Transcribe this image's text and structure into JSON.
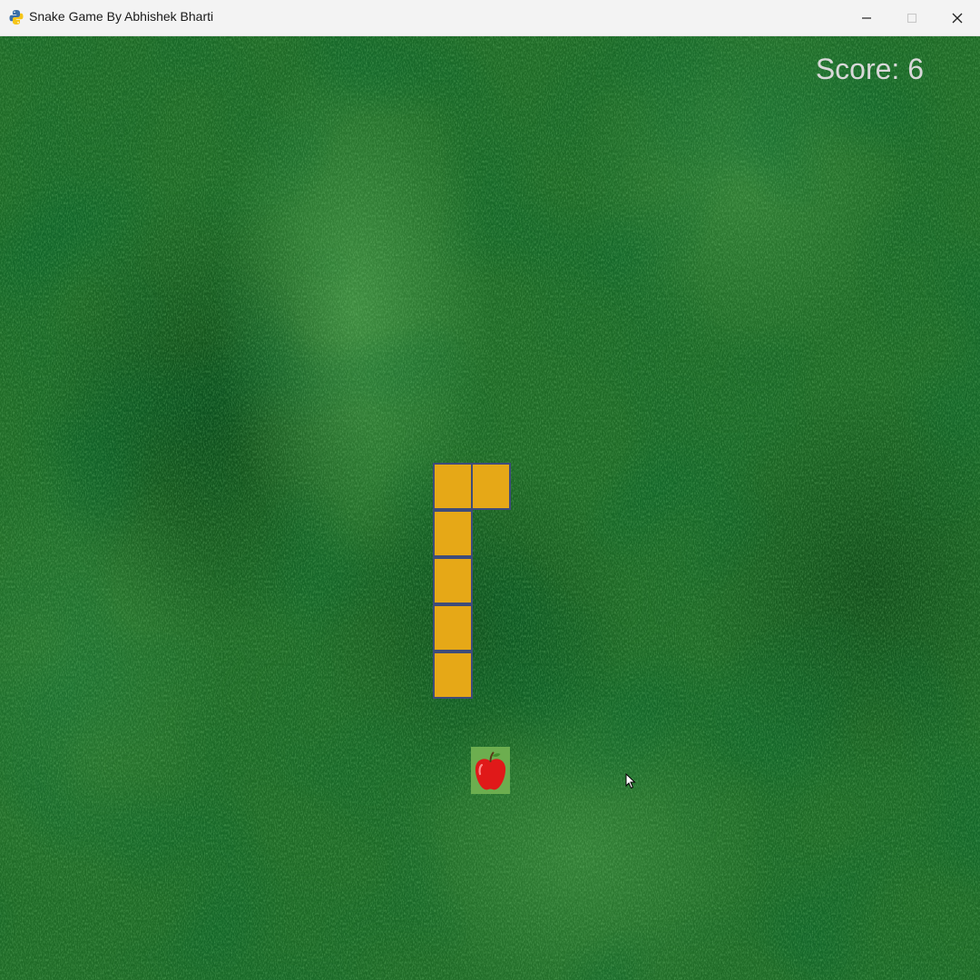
{
  "window": {
    "title": "Snake Game By Abhishek Bharti",
    "icon": "python-icon",
    "controls": [
      "minimize-icon",
      "maximize-icon",
      "close-icon"
    ]
  },
  "game": {
    "score_text": "Score: 6",
    "score": 6,
    "snake_length": 6,
    "snake_color": "#e6a817",
    "snake_border_color": "#3e4c7a",
    "background_color": "#1f6b27",
    "food": "apple-icon",
    "food_color": "#e01919"
  }
}
